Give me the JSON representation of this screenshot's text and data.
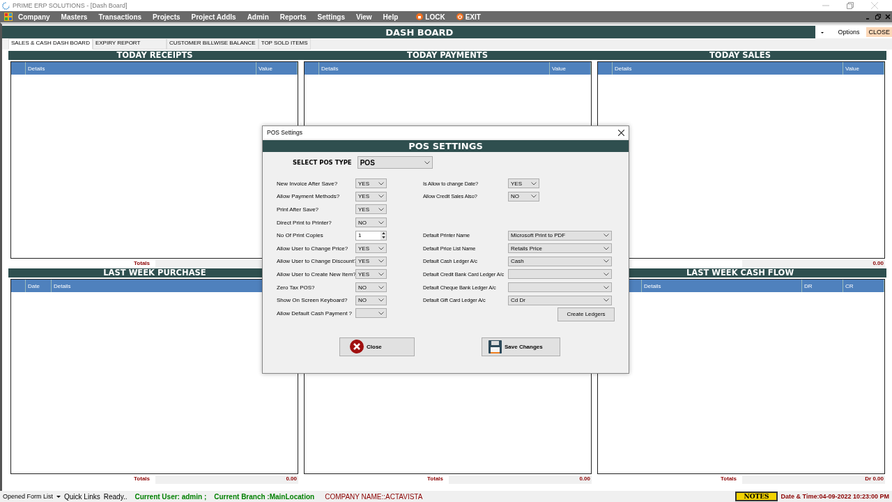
{
  "window": {
    "title": "PRIME ERP SOLUTIONS - [Dash Board]"
  },
  "menu": [
    {
      "label": "Company",
      "kind": "plain"
    },
    {
      "label": "Masters",
      "kind": "plain"
    },
    {
      "label": "Transactions",
      "kind": "plain"
    },
    {
      "label": "Projects",
      "kind": "plain"
    },
    {
      "label": "Project Addls",
      "kind": "plain"
    },
    {
      "label": "Admin",
      "kind": "plain"
    },
    {
      "label": "Reports",
      "kind": "plain"
    },
    {
      "label": "Settings",
      "kind": "plain"
    },
    {
      "label": "View",
      "kind": "plain"
    },
    {
      "label": "Help",
      "kind": "plain"
    },
    {
      "label": "LOCK",
      "kind": "lock"
    },
    {
      "label": "EXIT",
      "kind": "exit"
    }
  ],
  "dashboard": {
    "title": "DASH BOARD",
    "options": "Options",
    "close": "CLOSE"
  },
  "tabs": [
    {
      "label": "SALES & CASH DASH BOARD",
      "selected": true
    },
    {
      "label": "EXPIRY REPORT",
      "selected": false
    },
    {
      "label": "CUSTOMER BILLWISE BALANCE",
      "selected": false
    },
    {
      "label": "TOP SOLD ITEMS",
      "selected": false
    }
  ],
  "top_panels": [
    {
      "title": "TODAY RECEIPTS",
      "columns": [
        "Details",
        "Value"
      ],
      "totals_label": "Totals"
    },
    {
      "title": "TODAY PAYMENTS",
      "columns": [
        "Details",
        "Value"
      ]
    },
    {
      "title": "TODAY SALES",
      "columns": [
        "Details",
        "Value"
      ],
      "totals_value": "0.00"
    }
  ],
  "bottom_panels": [
    {
      "title": "LAST WEEK PURCHASE",
      "columns": [
        "Date",
        "Details"
      ],
      "totals_label": "Totals",
      "totals_value": "0.00"
    },
    {
      "totals_label": "Totals",
      "totals_value": "0.00"
    },
    {
      "title": "LAST WEEK CASH FLOW",
      "columns": [
        "Details",
        "DR",
        "CR"
      ],
      "totals_label": "Totals",
      "totals_value": "Dr 0.00"
    }
  ],
  "dialog": {
    "title": "POS Settings",
    "heading": "POS SETTINGS",
    "pos_type_label": "SELECT POS TYPE",
    "pos_type": "POS",
    "left_fields": [
      {
        "label": "New Invoice After Save?",
        "value": "YES",
        "kind": "select"
      },
      {
        "label": "Allow Payment Methods?",
        "value": "YES",
        "kind": "select"
      },
      {
        "label": "Print After Save?",
        "value": "YES",
        "kind": "select"
      },
      {
        "label": "Direct Print to Printer?",
        "value": "NO",
        "kind": "select"
      },
      {
        "label": "No Of Print Copies",
        "value": "1",
        "kind": "number"
      },
      {
        "label": "Allow User to Change Price?",
        "value": "YES",
        "kind": "select"
      },
      {
        "label": "Allow User to Change Discount?",
        "value": "YES",
        "kind": "select"
      },
      {
        "label": "Allow User to Create New Item?",
        "value": "YES",
        "kind": "select"
      },
      {
        "label": "Zero Tax POS?",
        "value": "NO",
        "kind": "select"
      },
      {
        "label": "Show On Screen Keyboard?",
        "value": "NO",
        "kind": "select"
      },
      {
        "label": "Allow Default Cash Payment ?",
        "kind": "select"
      }
    ],
    "right_top_fields": [
      {
        "label": "Is Allow to change Date?",
        "value": "YES"
      },
      {
        "label": "Allow Credit Sales Also?",
        "value": "NO"
      }
    ],
    "ledger_fields": [
      {
        "label": "Default Printer Name",
        "value": "Microsoft Print to PDF"
      },
      {
        "label": "Default Price List Name",
        "value": "Retails Price"
      },
      {
        "label": "Default Cash Ledger A/c",
        "value": "Cash"
      },
      {
        "label": "Default Credit Bank Card Ledger A/c"
      },
      {
        "label": "Default Cheque Bank Ledger A/c"
      },
      {
        "label": "Default Gift Card Ledger A/c",
        "value": "Cd Dr"
      }
    ],
    "create_ledgers": "Create Ledgers",
    "close_button": "Close",
    "save_button": "Save Changes"
  },
  "status_bar": {
    "opened_forms": "Opened Form List",
    "quick_links": "Quick Links",
    "ready": "Ready..",
    "user": "Current User: admin ;",
    "branch": "Current Branch :MainLocation",
    "company": "COMPANY NAME::ACTAVISTA",
    "notes": "NOTES",
    "datetime": "Date & Time:04-09-2022 10:23:00 PM"
  }
}
